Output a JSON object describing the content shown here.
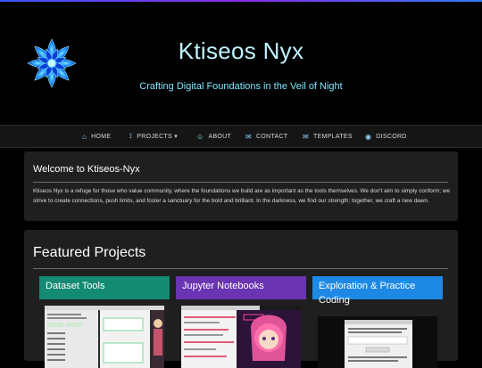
{
  "site": {
    "title": "Ktiseos Nyx",
    "subtitle": "Crafting Digital Foundations in the Veil of Night"
  },
  "nav": {
    "items": [
      {
        "label": "HOME",
        "icon": "home-icon"
      },
      {
        "label": "PROJECTS ▾",
        "icon": "sitemap-icon"
      },
      {
        "label": "ABOUT",
        "icon": "user-icon"
      },
      {
        "label": "CONTACT",
        "icon": "envelope-icon"
      },
      {
        "label": "TEMPLATES",
        "icon": "envelope-icon"
      },
      {
        "label": "DISCORD",
        "icon": "discord-icon"
      }
    ]
  },
  "welcome": {
    "heading": "Welcome to Ktiseos-Nyx",
    "body": "Ktiseos Nyx is a refuge for those who value community, where the foundations we build are as important as the tools themselves. We don't aim to simply conform; we strive to create connections, push limits, and foster a sanctuary for the bold and brilliant. In the darkness, we find our strength; together, we craft a new dawn."
  },
  "featured": {
    "heading": "Featured Projects",
    "cards": [
      {
        "title": "Dataset Tools",
        "color": "#138a72"
      },
      {
        "title": "Jupyter Notebooks",
        "color": "#6a34b3"
      },
      {
        "title": "Exploration & Practice Coding",
        "color": "#1e88e5"
      }
    ]
  },
  "colors": {
    "accent_cyan": "#7fe6ff",
    "nav_bg": "#151515",
    "panel_bg": "#1f1f1f"
  }
}
